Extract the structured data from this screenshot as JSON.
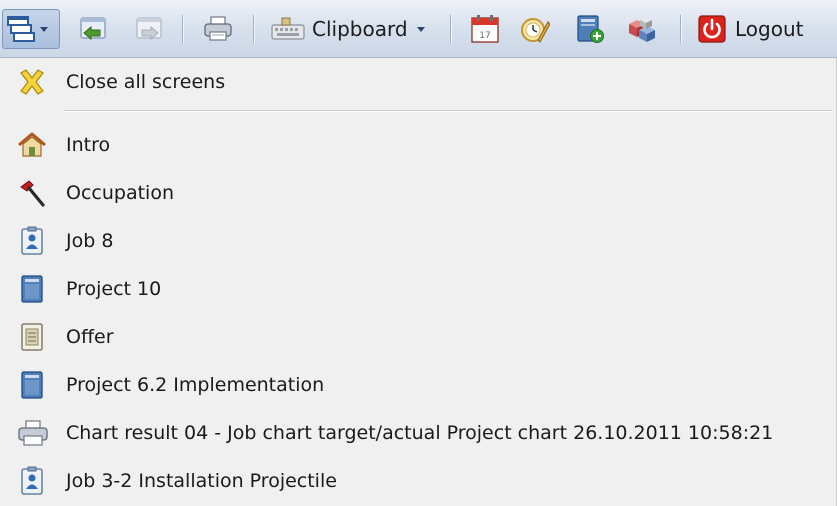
{
  "toolbar": {
    "clipboard_label": "Clipboard",
    "logout_label": "Logout",
    "icons": [
      "windows-menu-icon",
      "back-icon",
      "forward-icon",
      "print-icon",
      "clipboard-icon",
      "calendar-icon",
      "alarm-clock-icon",
      "add-document-icon",
      "cubes-icon",
      "power-icon"
    ]
  },
  "menu": {
    "close_all": "Close all screens",
    "items": [
      {
        "label": "Intro",
        "icon": "home-icon"
      },
      {
        "label": "Occupation",
        "icon": "hammer-icon"
      },
      {
        "label": "Job 8",
        "icon": "job-badge-icon"
      },
      {
        "label": "Project 10",
        "icon": "project-book-icon"
      },
      {
        "label": "Offer",
        "icon": "offer-sheet-icon"
      },
      {
        "label": "Project 6.2 Implementation",
        "icon": "project-book-icon"
      },
      {
        "label": "Chart result 04 - Job chart target/actual Project chart 26.10.2011 10:58:21",
        "icon": "print-icon"
      },
      {
        "label": "Job 3-2 Installation Projectile",
        "icon": "job-badge-icon"
      }
    ]
  },
  "colors": {
    "toolbar_top": "#eef2f8",
    "toolbar_bottom": "#cbd6e6",
    "menu_bg": "#f0f0f0",
    "logout_red": "#d9231b"
  }
}
